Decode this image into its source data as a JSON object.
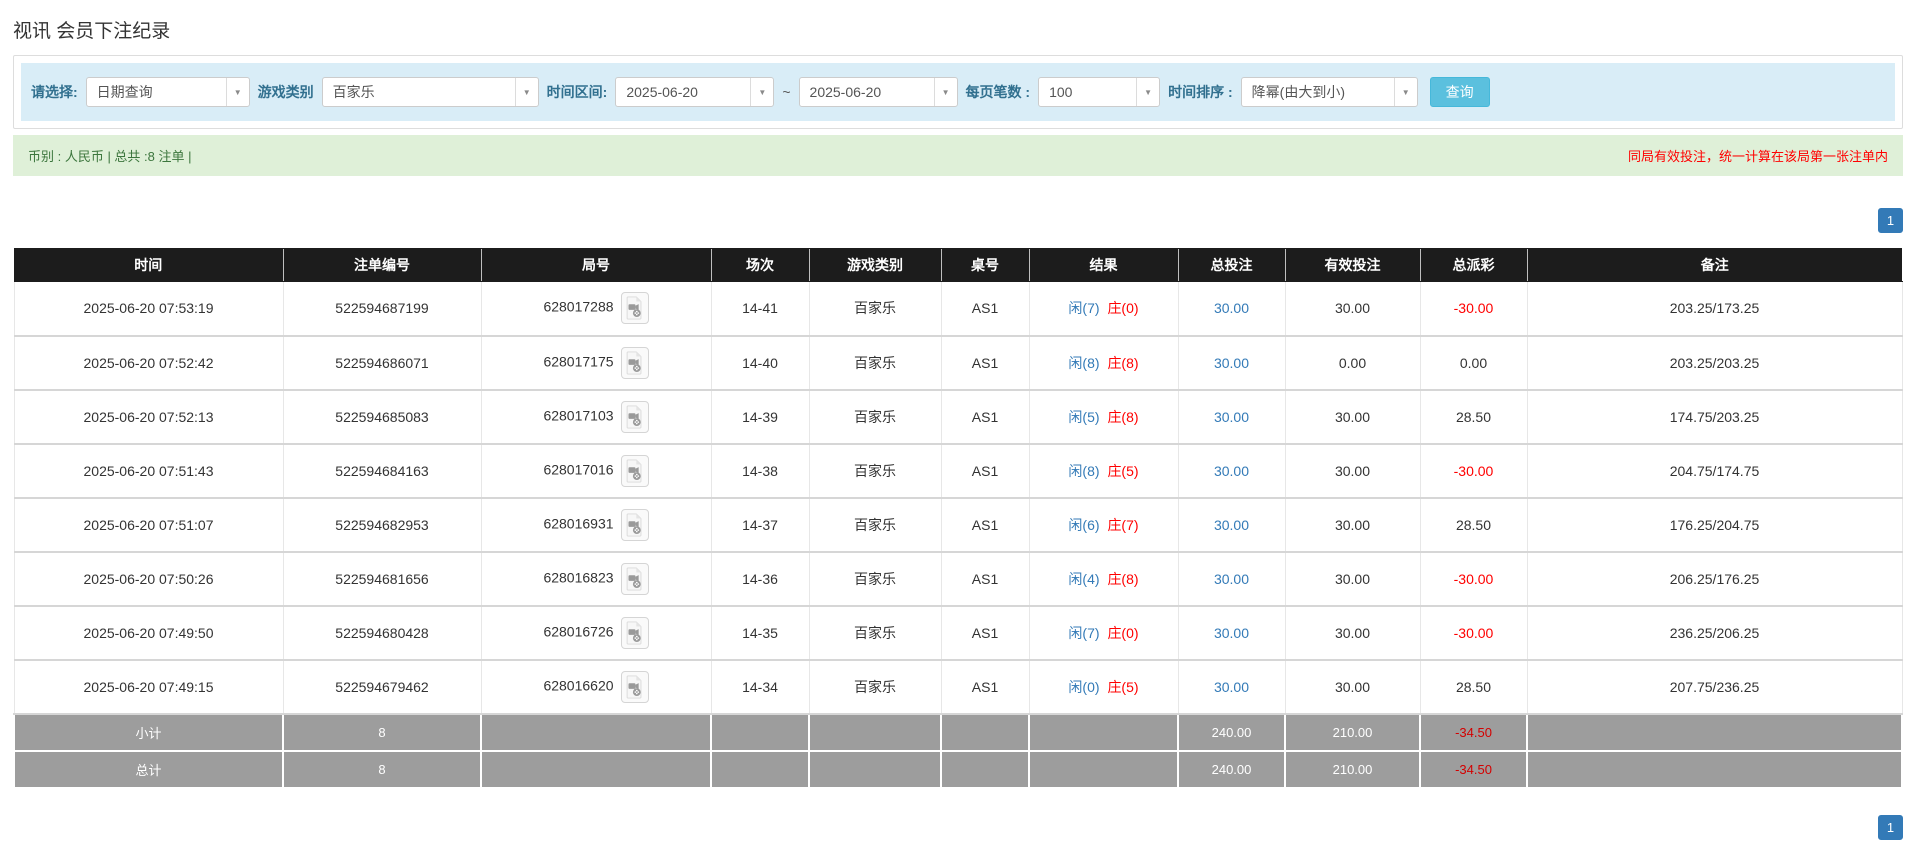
{
  "page": {
    "title": "视讯 会员下注纪录"
  },
  "filters": {
    "query_type": {
      "label": "请选择:",
      "value": "日期查询"
    },
    "game_type": {
      "label": "游戏类别",
      "value": "百家乐"
    },
    "date_range": {
      "label": "时间区间:",
      "from": "2025-06-20",
      "separator": "~",
      "to": "2025-06-20"
    },
    "page_size": {
      "label": "每页笔数 :",
      "value": "100"
    },
    "time_order": {
      "label": "时间排序 :",
      "value": "降幂(由大到小)"
    },
    "search_button": "查询"
  },
  "summary": {
    "text": "币别 : 人民币 | 总共 :8 注单 |",
    "notice": "同局有效投注，统一计算在该局第一张注单内"
  },
  "pagination": {
    "page": "1"
  },
  "table": {
    "columns": [
      "时间",
      "注单编号",
      "局号",
      "场次",
      "游戏类别",
      "桌号",
      "结果",
      "总投注",
      "有效投注",
      "总派彩",
      "备注"
    ],
    "rows": [
      {
        "time": "2025-06-20 07:53:19",
        "bet_id": "522594687199",
        "round_id": "628017288",
        "session": "14-41",
        "game": "百家乐",
        "table_no": "AS1",
        "result_player": "闲(7)",
        "result_banker": "庄(0)",
        "total_bet": "30.00",
        "valid_bet": "30.00",
        "payout": "-30.00",
        "remark": "203.25/173.25"
      },
      {
        "time": "2025-06-20 07:52:42",
        "bet_id": "522594686071",
        "round_id": "628017175",
        "session": "14-40",
        "game": "百家乐",
        "table_no": "AS1",
        "result_player": "闲(8)",
        "result_banker": "庄(8)",
        "total_bet": "30.00",
        "valid_bet": "0.00",
        "payout": "0.00",
        "remark": "203.25/203.25"
      },
      {
        "time": "2025-06-20 07:52:13",
        "bet_id": "522594685083",
        "round_id": "628017103",
        "session": "14-39",
        "game": "百家乐",
        "table_no": "AS1",
        "result_player": "闲(5)",
        "result_banker": "庄(8)",
        "total_bet": "30.00",
        "valid_bet": "30.00",
        "payout": "28.50",
        "remark": "174.75/203.25"
      },
      {
        "time": "2025-06-20 07:51:43",
        "bet_id": "522594684163",
        "round_id": "628017016",
        "session": "14-38",
        "game": "百家乐",
        "table_no": "AS1",
        "result_player": "闲(8)",
        "result_banker": "庄(5)",
        "total_bet": "30.00",
        "valid_bet": "30.00",
        "payout": "-30.00",
        "remark": "204.75/174.75"
      },
      {
        "time": "2025-06-20 07:51:07",
        "bet_id": "522594682953",
        "round_id": "628016931",
        "session": "14-37",
        "game": "百家乐",
        "table_no": "AS1",
        "result_player": "闲(6)",
        "result_banker": "庄(7)",
        "total_bet": "30.00",
        "valid_bet": "30.00",
        "payout": "28.50",
        "remark": "176.25/204.75"
      },
      {
        "time": "2025-06-20 07:50:26",
        "bet_id": "522594681656",
        "round_id": "628016823",
        "session": "14-36",
        "game": "百家乐",
        "table_no": "AS1",
        "result_player": "闲(4)",
        "result_banker": "庄(8)",
        "total_bet": "30.00",
        "valid_bet": "30.00",
        "payout": "-30.00",
        "remark": "206.25/176.25"
      },
      {
        "time": "2025-06-20 07:49:50",
        "bet_id": "522594680428",
        "round_id": "628016726",
        "session": "14-35",
        "game": "百家乐",
        "table_no": "AS1",
        "result_player": "闲(7)",
        "result_banker": "庄(0)",
        "total_bet": "30.00",
        "valid_bet": "30.00",
        "payout": "-30.00",
        "remark": "236.25/206.25"
      },
      {
        "time": "2025-06-20 07:49:15",
        "bet_id": "522594679462",
        "round_id": "628016620",
        "session": "14-34",
        "game": "百家乐",
        "table_no": "AS1",
        "result_player": "闲(0)",
        "result_banker": "庄(5)",
        "total_bet": "30.00",
        "valid_bet": "30.00",
        "payout": "28.50",
        "remark": "207.75/236.25"
      }
    ],
    "subtotal": {
      "label": "小计",
      "count": "8",
      "total_bet": "240.00",
      "valid_bet": "210.00",
      "payout": "-34.50"
    },
    "total": {
      "label": "总计",
      "count": "8",
      "total_bet": "240.00",
      "valid_bet": "210.00",
      "payout": "-34.50"
    }
  },
  "colors": {
    "accent_blue": "#337ab7",
    "search_button_blue": "#5bc0de",
    "filter_bg": "#d9edf7",
    "summary_bg": "#dff0d8",
    "player_blue": "#337ab7",
    "banker_red": "#ff0000",
    "negative_red": "#ff0000",
    "header_bg": "#1c1c1c",
    "total_row_bg": "#9d9d9d"
  }
}
